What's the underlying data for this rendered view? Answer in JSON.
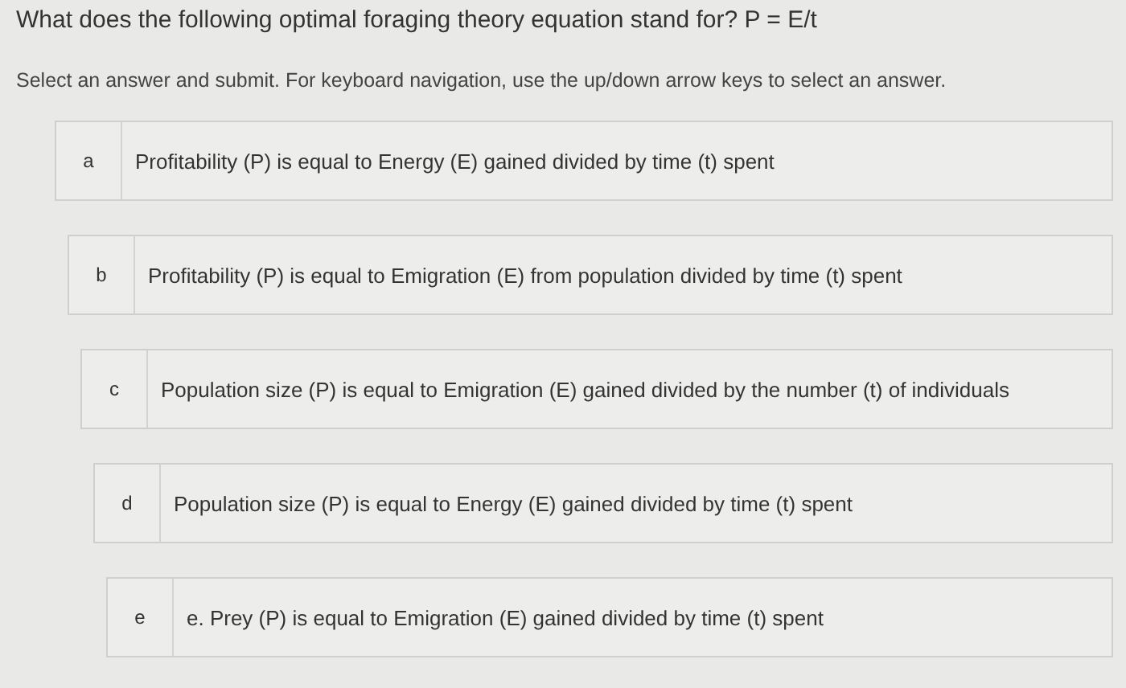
{
  "question": "What does the following optimal foraging theory equation stand for? P = E/t",
  "instructions": "Select an answer and submit. For keyboard navigation, use the up/down arrow keys to select an answer.",
  "options": [
    {
      "letter": "a",
      "text": "Profitability (P) is equal to Energy (E) gained divided by time (t) spent"
    },
    {
      "letter": "b",
      "text": "Profitability (P) is equal to Emigration (E) from population divided by time (t) spent"
    },
    {
      "letter": "c",
      "text": "Population size (P) is equal to Emigration (E) gained divided by the number (t) of individuals"
    },
    {
      "letter": "d",
      "text": "Population size (P) is equal to Energy (E) gained divided by time (t) spent"
    },
    {
      "letter": "e",
      "text": "e. Prey (P) is equal to Emigration (E) gained divided by time (t) spent"
    }
  ]
}
